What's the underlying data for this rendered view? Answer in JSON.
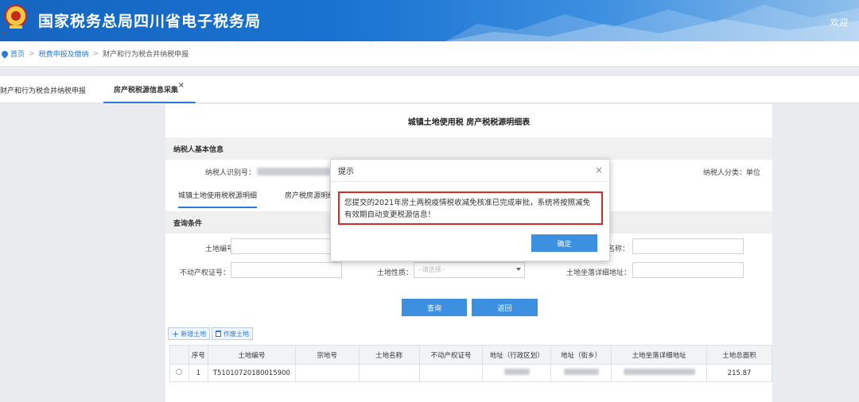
{
  "header": {
    "site_title": "国家税务总局四川省电子税务局",
    "welcome": "欢迎"
  },
  "breadcrumb": {
    "home": "首页",
    "level1": "税费申报及缴纳",
    "current": "财产和行为税合并纳税申报",
    "separator": ">"
  },
  "tabs": [
    {
      "label": "财产和行为税合并纳税申报"
    },
    {
      "label": "房产税税源信息采集",
      "close": "×"
    }
  ],
  "form": {
    "title": "城镇土地使用税  房产税税源明细表",
    "taxpayer_section": "纳税人基本信息",
    "taxpayer_id_label": "纳税人识别号：",
    "taxpayer_type_label": "纳税人分类：",
    "taxpayer_type_value": "单位",
    "subtabs": [
      "城镇土地使用税税源明细",
      "房产税房源明细"
    ],
    "query_section": "查询条件",
    "land_no_label": "土地编号：",
    "name_label": "名称：",
    "property_cert_label": "不动产权证号：",
    "land_nature_label": "土地性质：",
    "land_nature_placeholder": "--请选择--",
    "land_address_label": "土地坐落详细地址：",
    "query_button": "查询",
    "back_button": "返回",
    "add_land_button": "新增土地",
    "void_land_button": "作废土地"
  },
  "table": {
    "headers": [
      "",
      "序号",
      "土地编号",
      "宗地号",
      "土地名称",
      "不动产权证号",
      "地址（行政区划）",
      "地址（街乡）",
      "土地坐落详细地址",
      "土地总面积"
    ],
    "rows": [
      {
        "index": "1",
        "land_no": "T51010720180015900",
        "area": "215.87"
      }
    ]
  },
  "modal": {
    "title": "提示",
    "close": "×",
    "message": "您提交的2021年房土两税疫情税收减免核准已完成审批，系统将按照减免有效期自动变更税源信息！",
    "ok_button": "确定"
  },
  "colors": {
    "header_blue": "#1565c0",
    "accent_blue": "#3d8fe0",
    "highlight_red": "#d42b2b"
  }
}
